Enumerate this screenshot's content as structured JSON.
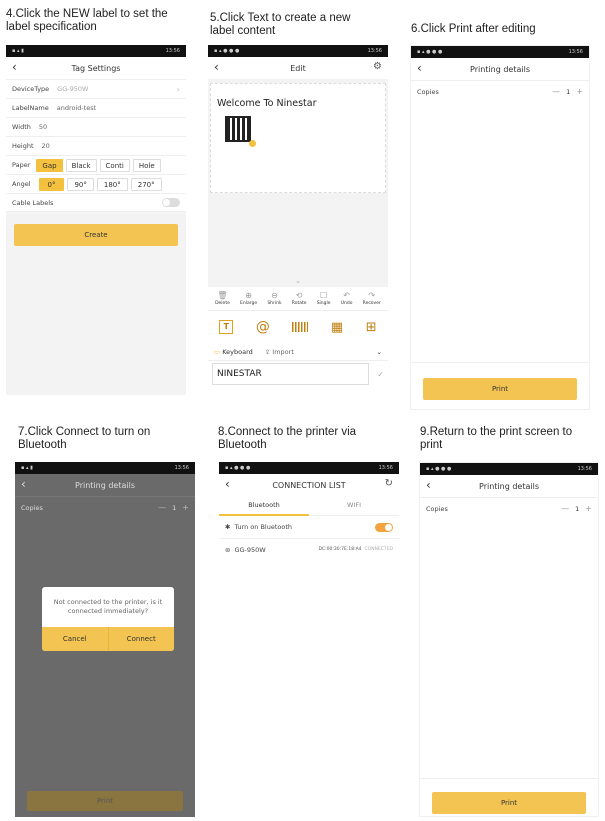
{
  "captions": {
    "c4": "4.Click the NEW label to set the\nlabel specification",
    "c5": "5.Click Text to create a new\nlabel content",
    "c6": "6.Click Print after editing",
    "c7": "7.Click Connect to turn on\nBluetooth",
    "c8": "8.Connect to the printer via\nBluetooth",
    "c9": "9.Return to the print screen to\nprint"
  },
  "tag": {
    "title": "Tag Settings",
    "device_label": "DeviceType",
    "device_value": "GG-950W",
    "name_label": "LabelName",
    "name_value": "android-test",
    "width_label": "Width",
    "width_value": "50",
    "height_label": "Height",
    "height_value": "20",
    "paper_label": "Paper",
    "paper_opts": [
      "Gap",
      "Black",
      "Conti",
      "Hole"
    ],
    "angle_label": "Angel",
    "angle_opts": [
      "0°",
      "90°",
      "180°",
      "270°"
    ],
    "cable_label": "Cable Labels",
    "create": "Create"
  },
  "edit": {
    "title": "Edit",
    "canvas_text": "Welcome To Ninestar",
    "tools": [
      "Delete",
      "Enlarge",
      "Shrink",
      "Rotate",
      "Single",
      "Undo",
      "Recover"
    ],
    "keyboard": "Keyboard",
    "import": "Import",
    "input_value": "NINESTAR"
  },
  "print6": {
    "title": "Printing details",
    "copies": "Copies",
    "count": "1",
    "print": "Print"
  },
  "print7": {
    "title": "Printing details",
    "copies": "Copies",
    "count": "1",
    "print": "Print",
    "dialog_msg": "Not connected to the printer, is it connected immediately?",
    "cancel": "Cancel",
    "connect": "Connect"
  },
  "conn": {
    "title": "CONNECTION LIST",
    "tab_bt": "Bluetooth",
    "tab_wifi": "WIFI",
    "turn_on": "Turn on Bluetooth",
    "device": "GG-950W",
    "mac": "DC:00:30:7E:18:A4",
    "status": "CONNECTED"
  },
  "print9": {
    "title": "Printing details",
    "copies": "Copies",
    "count": "1",
    "print": "Print"
  },
  "colors": {
    "accent": "#f3c452",
    "toggle": "#f3a43e"
  },
  "status_time": "13:56"
}
